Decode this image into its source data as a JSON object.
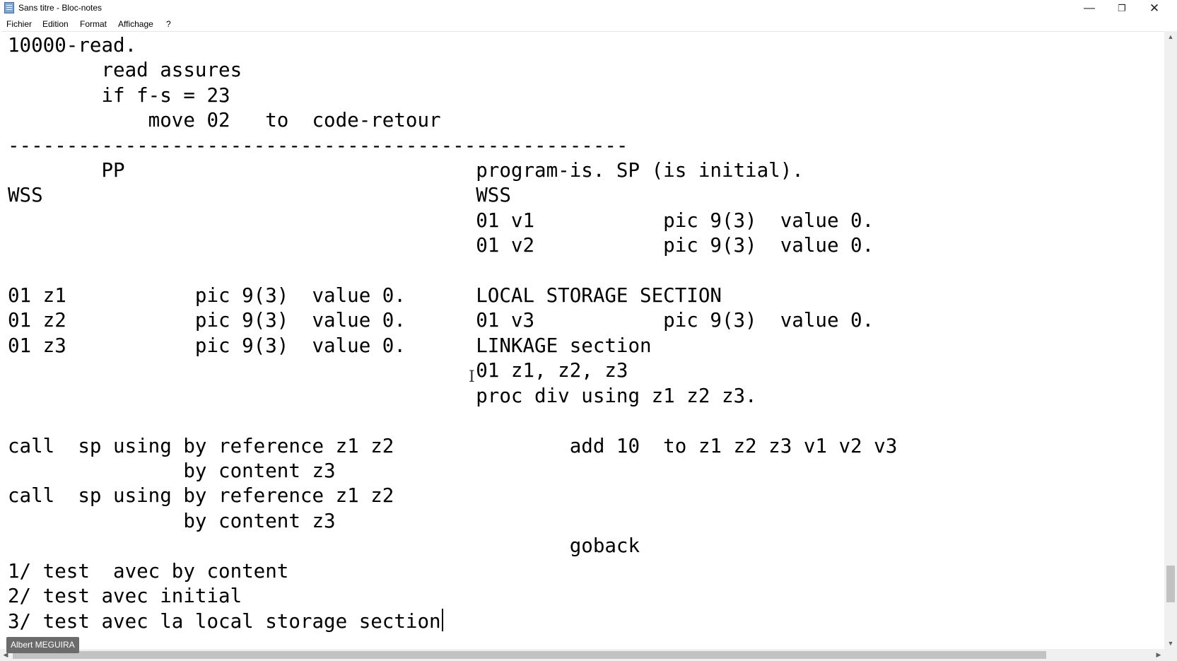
{
  "window": {
    "title": "Sans titre - Bloc-notes",
    "app_icon": "notepad-icon",
    "controls": {
      "minimize": "—",
      "maximize": "❐",
      "close": "✕"
    }
  },
  "menu": {
    "fichier": "Fichier",
    "edition": "Edition",
    "format": "Format",
    "affichage": "Affichage",
    "help": "?"
  },
  "editor": {
    "text": "10000-read.\n        read assures\n        if f-s = 23\n            move 02   to  code-retour\n-----------------------------------------------------\n        PP                              program-is. SP (is initial).\nWSS                                     WSS\n                                        01 v1           pic 9(3)  value 0.\n                                        01 v2           pic 9(3)  value 0.\n\n01 z1           pic 9(3)  value 0.      LOCAL STORAGE SECTION\n01 z2           pic 9(3)  value 0.      01 v3           pic 9(3)  value 0.\n01 z3           pic 9(3)  value 0.      LINKAGE section\n                                        01 z1, z2, z3\n                                        proc div using z1 z2 z3.\n\ncall  sp using by reference z1 z2               add 10  to z1 z2 z3 v1 v2 v3\n               by content z3\ncall  sp using by reference z1 z2\n               by content z3\n                                                goback\n1/ test  avec by content\n2/ test avec initial\n3/ test avec la local storage section"
  },
  "scrollbars": {
    "up_arrow": "▲",
    "down_arrow": "▼",
    "left_arrow": "◀",
    "right_arrow": "▶"
  },
  "presenter": {
    "name": "Albert MEGUIRA"
  },
  "colors": {
    "background": "#ffffff",
    "text": "#000000",
    "scrollbar": "#f0f0f0",
    "thumb": "#c2c2c2"
  }
}
